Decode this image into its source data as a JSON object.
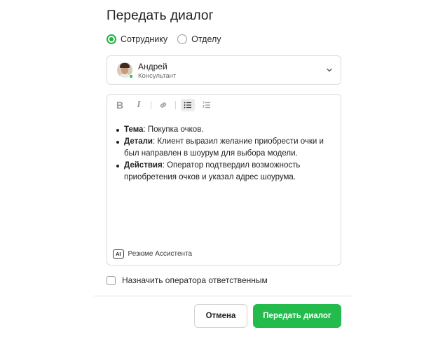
{
  "dialog": {
    "title": "Передать диалог"
  },
  "transfer_target": {
    "options": [
      {
        "label": "Сотруднику",
        "selected": true
      },
      {
        "label": "Отделу",
        "selected": false
      }
    ]
  },
  "agent_select": {
    "name": "Андрей",
    "role": "Консультант",
    "status": "online",
    "icon": "chevron-down-icon"
  },
  "editor": {
    "toolbar": [
      "bold",
      "italic",
      "link",
      "bulleted-list",
      "numbered-list"
    ],
    "bullets": [
      {
        "term": "Тема",
        "text": ": Покупка очков."
      },
      {
        "term": "Детали",
        "text": ": Клиент выразил желание приобрести очки и был направлен в шоурум для выбора модели."
      },
      {
        "term": "Действия",
        "text": ": Оператор подтвердил возможность приобретения очков и указал адрес шоурума."
      }
    ],
    "ai_badge": "AI",
    "ai_label": "Резюме Ассистента"
  },
  "assign_checkbox": {
    "label": "Назначить оператора ответственным",
    "checked": false
  },
  "actions": {
    "cancel_label": "Отмена",
    "submit_label": "Передать диалог"
  },
  "colors": {
    "accent": "#22bb4c",
    "online": "#22c04f"
  }
}
